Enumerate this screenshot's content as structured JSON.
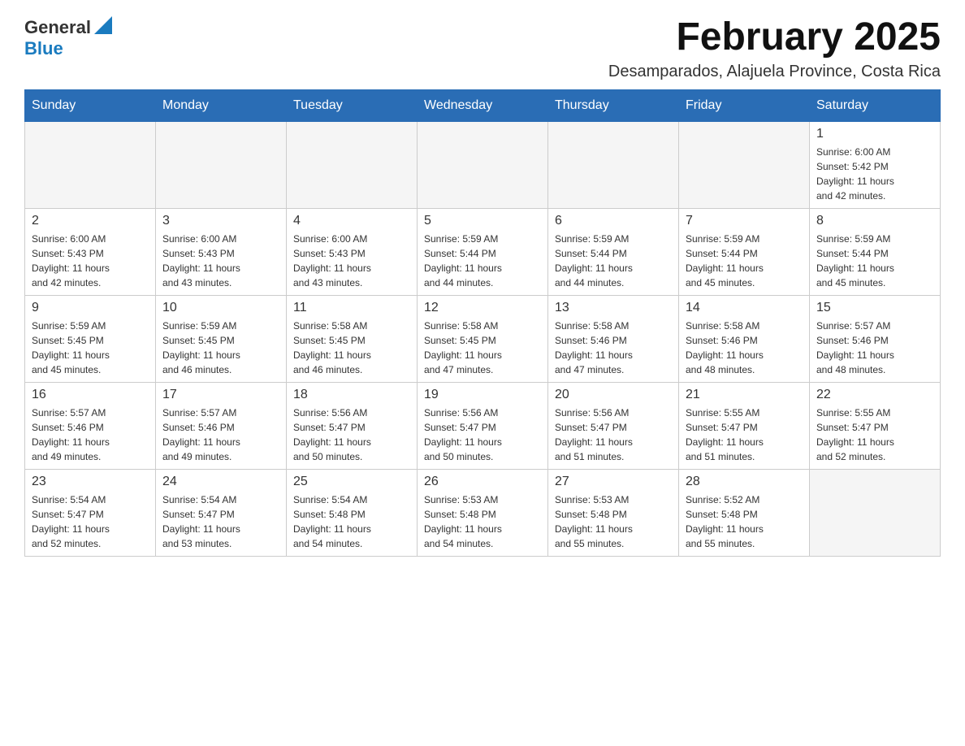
{
  "header": {
    "logo_line1": "General",
    "logo_line2": "Blue",
    "title": "February 2025",
    "subtitle": "Desamparados, Alajuela Province, Costa Rica"
  },
  "weekdays": [
    "Sunday",
    "Monday",
    "Tuesday",
    "Wednesday",
    "Thursday",
    "Friday",
    "Saturday"
  ],
  "weeks": [
    [
      {
        "day": "",
        "info": ""
      },
      {
        "day": "",
        "info": ""
      },
      {
        "day": "",
        "info": ""
      },
      {
        "day": "",
        "info": ""
      },
      {
        "day": "",
        "info": ""
      },
      {
        "day": "",
        "info": ""
      },
      {
        "day": "1",
        "info": "Sunrise: 6:00 AM\nSunset: 5:42 PM\nDaylight: 11 hours\nand 42 minutes."
      }
    ],
    [
      {
        "day": "2",
        "info": "Sunrise: 6:00 AM\nSunset: 5:43 PM\nDaylight: 11 hours\nand 42 minutes."
      },
      {
        "day": "3",
        "info": "Sunrise: 6:00 AM\nSunset: 5:43 PM\nDaylight: 11 hours\nand 43 minutes."
      },
      {
        "day": "4",
        "info": "Sunrise: 6:00 AM\nSunset: 5:43 PM\nDaylight: 11 hours\nand 43 minutes."
      },
      {
        "day": "5",
        "info": "Sunrise: 5:59 AM\nSunset: 5:44 PM\nDaylight: 11 hours\nand 44 minutes."
      },
      {
        "day": "6",
        "info": "Sunrise: 5:59 AM\nSunset: 5:44 PM\nDaylight: 11 hours\nand 44 minutes."
      },
      {
        "day": "7",
        "info": "Sunrise: 5:59 AM\nSunset: 5:44 PM\nDaylight: 11 hours\nand 45 minutes."
      },
      {
        "day": "8",
        "info": "Sunrise: 5:59 AM\nSunset: 5:44 PM\nDaylight: 11 hours\nand 45 minutes."
      }
    ],
    [
      {
        "day": "9",
        "info": "Sunrise: 5:59 AM\nSunset: 5:45 PM\nDaylight: 11 hours\nand 45 minutes."
      },
      {
        "day": "10",
        "info": "Sunrise: 5:59 AM\nSunset: 5:45 PM\nDaylight: 11 hours\nand 46 minutes."
      },
      {
        "day": "11",
        "info": "Sunrise: 5:58 AM\nSunset: 5:45 PM\nDaylight: 11 hours\nand 46 minutes."
      },
      {
        "day": "12",
        "info": "Sunrise: 5:58 AM\nSunset: 5:45 PM\nDaylight: 11 hours\nand 47 minutes."
      },
      {
        "day": "13",
        "info": "Sunrise: 5:58 AM\nSunset: 5:46 PM\nDaylight: 11 hours\nand 47 minutes."
      },
      {
        "day": "14",
        "info": "Sunrise: 5:58 AM\nSunset: 5:46 PM\nDaylight: 11 hours\nand 48 minutes."
      },
      {
        "day": "15",
        "info": "Sunrise: 5:57 AM\nSunset: 5:46 PM\nDaylight: 11 hours\nand 48 minutes."
      }
    ],
    [
      {
        "day": "16",
        "info": "Sunrise: 5:57 AM\nSunset: 5:46 PM\nDaylight: 11 hours\nand 49 minutes."
      },
      {
        "day": "17",
        "info": "Sunrise: 5:57 AM\nSunset: 5:46 PM\nDaylight: 11 hours\nand 49 minutes."
      },
      {
        "day": "18",
        "info": "Sunrise: 5:56 AM\nSunset: 5:47 PM\nDaylight: 11 hours\nand 50 minutes."
      },
      {
        "day": "19",
        "info": "Sunrise: 5:56 AM\nSunset: 5:47 PM\nDaylight: 11 hours\nand 50 minutes."
      },
      {
        "day": "20",
        "info": "Sunrise: 5:56 AM\nSunset: 5:47 PM\nDaylight: 11 hours\nand 51 minutes."
      },
      {
        "day": "21",
        "info": "Sunrise: 5:55 AM\nSunset: 5:47 PM\nDaylight: 11 hours\nand 51 minutes."
      },
      {
        "day": "22",
        "info": "Sunrise: 5:55 AM\nSunset: 5:47 PM\nDaylight: 11 hours\nand 52 minutes."
      }
    ],
    [
      {
        "day": "23",
        "info": "Sunrise: 5:54 AM\nSunset: 5:47 PM\nDaylight: 11 hours\nand 52 minutes."
      },
      {
        "day": "24",
        "info": "Sunrise: 5:54 AM\nSunset: 5:47 PM\nDaylight: 11 hours\nand 53 minutes."
      },
      {
        "day": "25",
        "info": "Sunrise: 5:54 AM\nSunset: 5:48 PM\nDaylight: 11 hours\nand 54 minutes."
      },
      {
        "day": "26",
        "info": "Sunrise: 5:53 AM\nSunset: 5:48 PM\nDaylight: 11 hours\nand 54 minutes."
      },
      {
        "day": "27",
        "info": "Sunrise: 5:53 AM\nSunset: 5:48 PM\nDaylight: 11 hours\nand 55 minutes."
      },
      {
        "day": "28",
        "info": "Sunrise: 5:52 AM\nSunset: 5:48 PM\nDaylight: 11 hours\nand 55 minutes."
      },
      {
        "day": "",
        "info": ""
      }
    ]
  ]
}
